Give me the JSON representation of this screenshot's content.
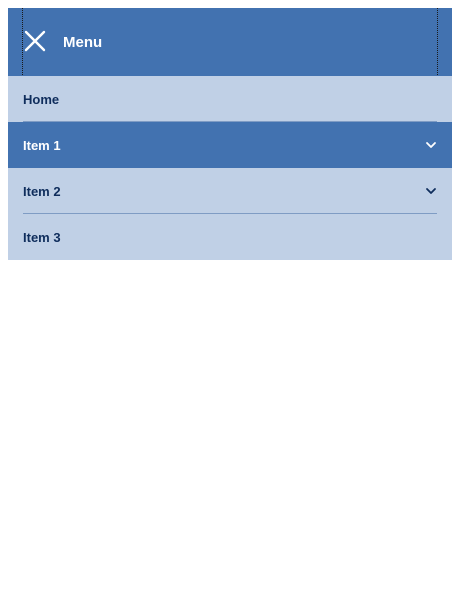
{
  "header": {
    "title": "Menu",
    "close_icon": "close-icon"
  },
  "items": [
    {
      "label": "Home",
      "has_children": false,
      "active": false
    },
    {
      "label": "Item 1",
      "has_children": true,
      "active": true
    },
    {
      "label": "Item 2",
      "has_children": true,
      "active": false
    },
    {
      "label": "Item 3",
      "has_children": false,
      "active": false
    }
  ],
  "colors": {
    "header_bg": "#4272b0",
    "list_bg": "#c0d0e6",
    "item_text": "#0f2d5c",
    "active_bg": "#4272b0",
    "active_text": "#ffffff"
  }
}
